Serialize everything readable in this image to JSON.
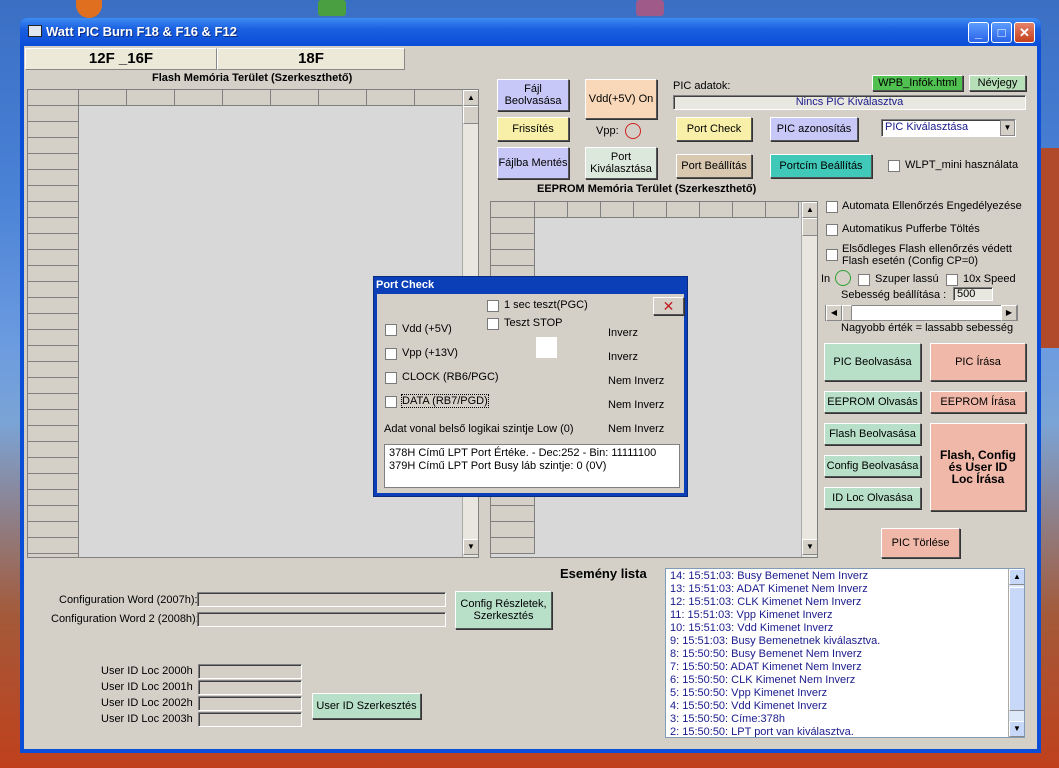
{
  "window": {
    "title": "Watt PIC Burn F18 & F16 & F12",
    "minimize": "_",
    "maximize": "□",
    "close": "✕"
  },
  "tabs": [
    "12F _16F",
    "18F"
  ],
  "flash": {
    "title": "Flash Memória Terület (Szerkeszthető)"
  },
  "eeprom": {
    "title": "EEPROM Memória Terület (Szerkeszthető)"
  },
  "buttons": {
    "file_read": "Fájl Beolvasása",
    "refresh": "Frissítés",
    "file_save": "Fájlba Mentés",
    "vdd_on": "Vdd(+5V) On",
    "vpp_label": "Vpp:",
    "port_select": "Port Kiválasztása",
    "port_check": "Port Check",
    "pic_id": "PIC azonosítás",
    "port_setting": "Port Beállítás",
    "portcim": "Portcím Beállítás",
    "wpb_info": "WPB_Infók.html",
    "about": "Névjegy",
    "pic_read": "PIC Beolvasása",
    "pic_write": "PIC   Írása",
    "eeprom_read": "EEPROM Olvasás",
    "eeprom_write": "EEPROM Írása",
    "flash_read": "Flash Beolvasása",
    "config_read": "Config Beolvasása",
    "idloc_read": "ID Loc Olvasása",
    "flash_config_write": "Flash, Config és User ID Loc Írása",
    "pic_erase": "PIC  Törlése",
    "config_details": "Config Részletek, Szerkesztés",
    "userid_edit": "User ID Szerkesztés"
  },
  "pic": {
    "label": "PIC adatok:",
    "status": "Nincs PIC Kiválasztva",
    "select": "PIC Kiválasztása"
  },
  "options": {
    "wlpt": "WLPT_mini használata",
    "auto_check": "Automata Ellenőrzés Engedélyezése",
    "auto_buffer": "Automatikus Pufferbe Töltés",
    "primary_flash": "Elsődleges Flash ellenőrzés védett Flash esetén (Config CP=0)",
    "in_label": "In",
    "super_slow": "Szuper lassú",
    "speed10x": "10x Speed",
    "speed_setting": "Sebesség beállítása :",
    "speed_value": "500",
    "speed_hint": "Nagyobb érték = lassabb sebesség"
  },
  "config": {
    "word1": "Configuration Word (2007h):",
    "word2": "Configuration Word 2 (2008h):",
    "userid": [
      "User ID Loc 2000h",
      "User ID Loc 2001h",
      "User ID Loc 2002h",
      "User ID Loc 2003h"
    ]
  },
  "events": {
    "title": "Esemény lista",
    "items": [
      "14:  15:51:03:  Busy Bemenet Nem Inverz",
      "13:  15:51:03:  ADAT Kimenet Nem Inverz",
      "12:  15:51:03:  CLK Kimenet Nem Inverz",
      "11:  15:51:03:  Vpp Kimenet Inverz",
      "10:  15:51:03:  Vdd Kimenet Inverz",
      "9:  15:51:03:  Busy Bemenetnek kiválasztva.",
      "8:  15:50:50:  Busy Bemenet Nem Inverz",
      "7:  15:50:50:  ADAT Kimenet Nem Inverz",
      "6:  15:50:50:  CLK Kimenet Nem Inverz",
      "5:  15:50:50:  Vpp Kimenet Inverz",
      "4:  15:50:50:  Vdd Kimenet Inverz",
      "3:  15:50:50:  Címe:378h",
      "2:  15:50:50:  LPT port van kiválasztva."
    ]
  },
  "dialog": {
    "title": "Port Check",
    "close": "✕",
    "test1s": "1 sec teszt(PGC)",
    "test_stop": "Teszt STOP",
    "rows": [
      {
        "label": "Vdd (+5V)",
        "state": "Inverz"
      },
      {
        "label": "Vpp (+13V)",
        "state": "Inverz"
      },
      {
        "label": "CLOCK (RB6/PGC)",
        "state": "Nem Inverz"
      },
      {
        "label": "DATA (RB7/PGD)",
        "state": "Nem Inverz"
      }
    ],
    "data_low": "Adat vonal belső logikai szintje Low (0)",
    "data_low_state": "Nem Inverz",
    "log": [
      "378H Című LPT Port Értéke. - Dec:252 - Bin: 11111100",
      "379H Című LPT Port Busy láb szintje: 0 (0V)"
    ]
  },
  "colors": {
    "titlebar": "#0a4ed8",
    "client": "#d4d0c8",
    "purple_btn": "#c8c8f8",
    "peach_btn": "#f8d8b8",
    "green_btn": "#b8e0c8",
    "salmon_btn": "#f0b8a8",
    "teal_btn": "#40c8b8",
    "yellow_btn": "#f8f0a8",
    "event_text": "#1a1a8c"
  }
}
